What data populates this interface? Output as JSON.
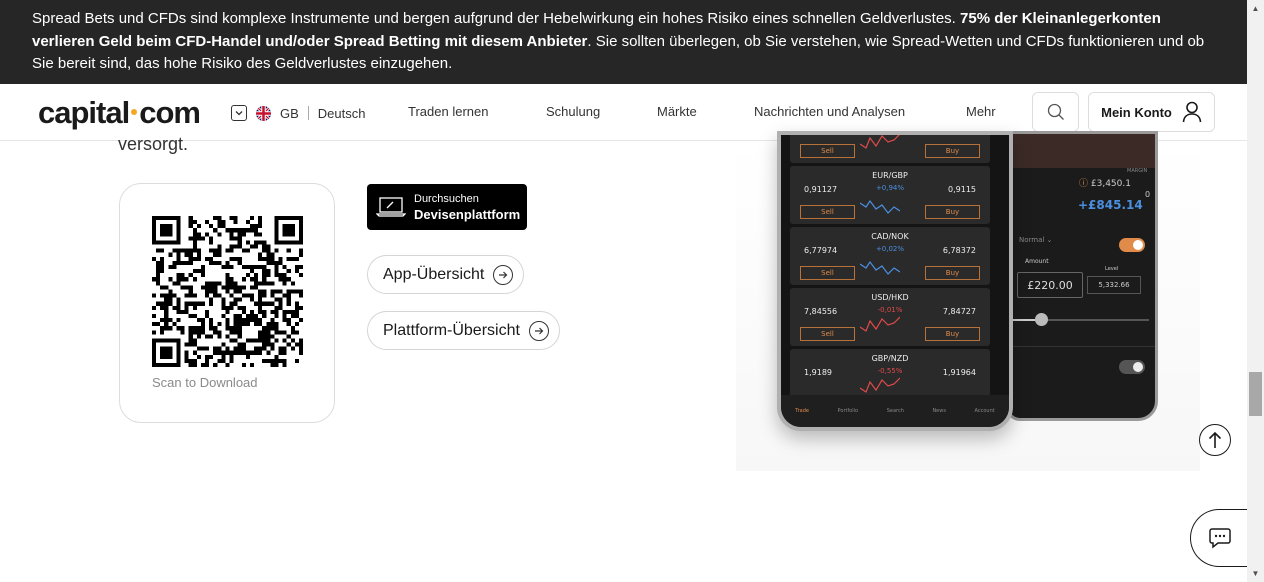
{
  "banner": {
    "text_part1": "Spread Bets und CFDs sind komplexe Instrumente und bergen aufgrund der Hebelwirkung ein hohes Risiko eines schnellen Geldverlustes. ",
    "bold": "75% der Kleinanlegerkonten verlieren Geld beim CFD-Handel und/oder Spread Betting mit diesem Anbieter",
    "text_part2": ". Sie sollten überlegen, ob Sie verstehen, wie Spread-Wetten und CFDs funktionieren und ob Sie bereit sind, das hohe Risiko des Geldverlustes einzugehen."
  },
  "header": {
    "logo_left": "capital",
    "logo_right": "com",
    "region": "GB",
    "language": "Deutsch",
    "nav": [
      "Traden lernen",
      "Schulung",
      "Märkte",
      "Nachrichten und Analysen",
      "Mehr"
    ],
    "account_label": "Mein Konto"
  },
  "content": {
    "intro_tail": "versorgt.",
    "qr_caption": "Scan to Download",
    "platform_button": {
      "small": "Durchsuchen",
      "big": "Devisenplattform"
    },
    "app_overview": "App-Übersicht",
    "platform_overview": "Plattform-Übersicht"
  },
  "phone_front": {
    "rows": [
      {
        "symbol": "",
        "change": "",
        "bid": "",
        "ask": "",
        "sell": "Sell",
        "buy": "Buy",
        "trend": "down"
      },
      {
        "symbol": "EUR/GBP",
        "change": "+0,94%",
        "bid": "0,91127",
        "ask": "0,9115",
        "sell": "Sell",
        "buy": "Buy",
        "trend": "up"
      },
      {
        "symbol": "CAD/NOK",
        "change": "+0,02%",
        "bid": "6,77974",
        "ask": "6,78372",
        "sell": "Sell",
        "buy": "Buy",
        "trend": "up"
      },
      {
        "symbol": "USD/HKD",
        "change": "-0,01%",
        "bid": "7,84556",
        "ask": "7,84727",
        "sell": "Sell",
        "buy": "Buy",
        "trend": "down"
      },
      {
        "symbol": "GBP/NZD",
        "change": "-0,55%",
        "bid": "1,9189",
        "ask": "1,91964",
        "sell": "",
        "buy": "",
        "trend": "down"
      }
    ],
    "tabs": [
      "Trade",
      "Portfolio",
      "Search",
      "News",
      "Account"
    ],
    "colors": {
      "up": "#4a8fe0",
      "down": "#e04a4a",
      "accent": "#e08b4a"
    }
  },
  "phone_back": {
    "margin_label": "MARGIN",
    "margin_value": "£3,450.1",
    "zero": "0",
    "pnl": "+£845.14",
    "mode": "Normal",
    "amount_label": "Amount",
    "level_label": "Level",
    "amount_value": "£220.00",
    "level_value": "5,332.66"
  }
}
